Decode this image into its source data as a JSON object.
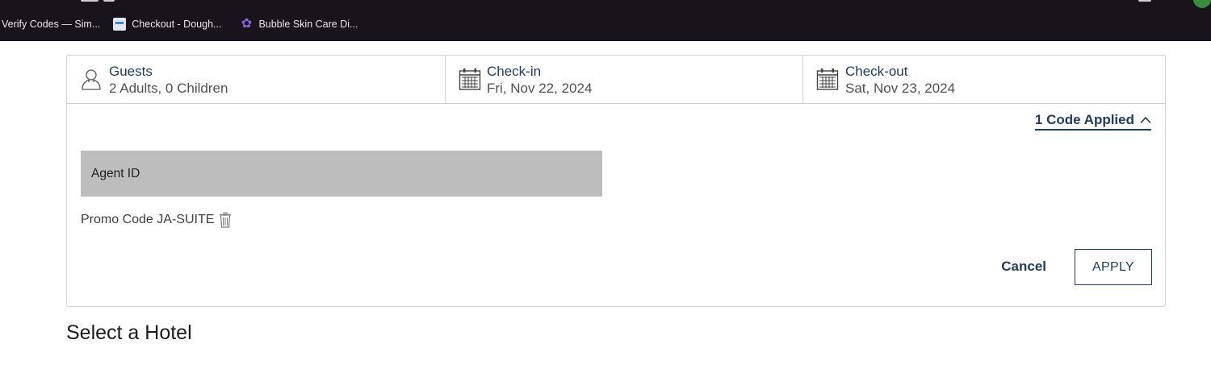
{
  "bookmarks": [
    {
      "label": "Verify Codes — Sim...",
      "icon": "none"
    },
    {
      "label": "Checkout - Dough...",
      "icon": "doc-favicon"
    },
    {
      "label": "Bubble Skin Care Di...",
      "icon": "flower-favicon"
    }
  ],
  "booking": {
    "guests": {
      "label": "Guests",
      "value": "2 Adults, 0 Children",
      "icon": "person-icon"
    },
    "checkin": {
      "label": "Check-in",
      "value": "Fri, Nov 22, 2024",
      "icon": "calendar-icon"
    },
    "checkout": {
      "label": "Check-out",
      "value": "Sat, Nov 23, 2024",
      "icon": "calendar-icon"
    },
    "codes_toggle_label": "1 Code Applied",
    "agent_id_placeholder": "Agent ID",
    "promo_text": "Promo Code JA-SUITE",
    "cancel_label": "Cancel",
    "apply_label": "APPLY"
  },
  "section_title": "Select a Hotel",
  "colors": {
    "navy": "#1f3a5c",
    "chrome_bg": "#19141c",
    "input_bg": "#bdbdbd",
    "border": "#d3d3d3"
  }
}
